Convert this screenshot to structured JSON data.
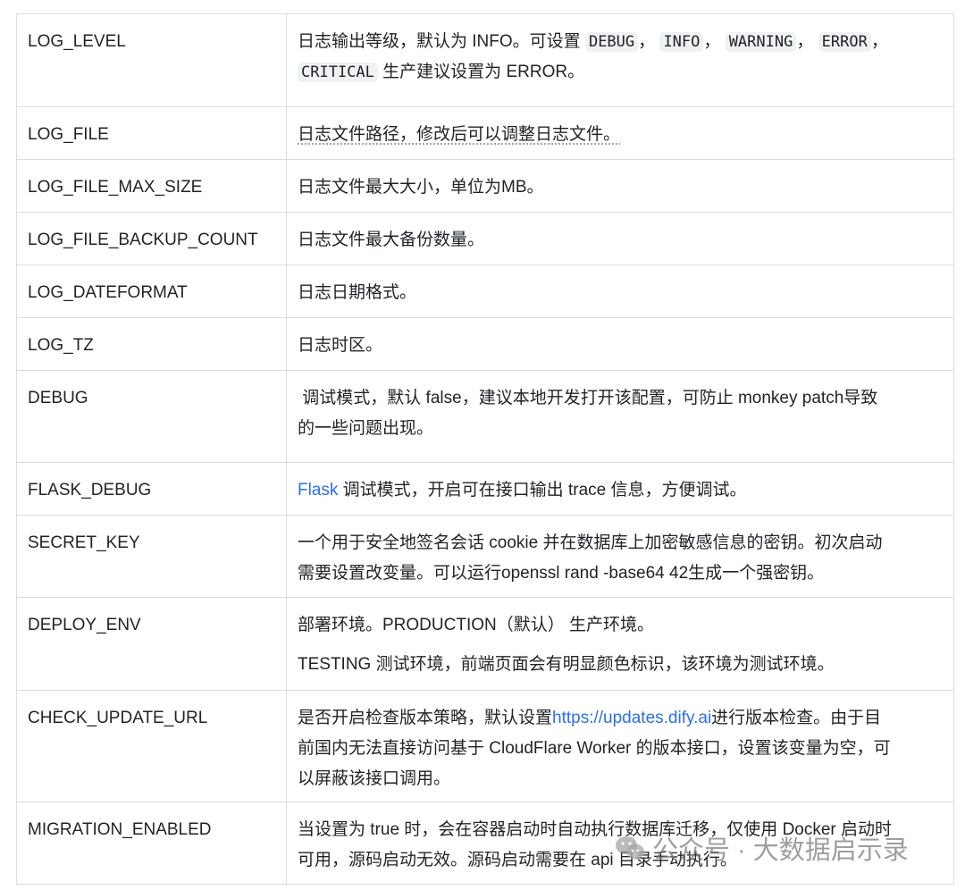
{
  "rows": [
    {
      "key": "LOG_LEVEL",
      "desc": {
        "intro": "日志输出等级，默认为 INFO。可设置",
        "codes": [
          "DEBUG",
          "INFO",
          "WARNING",
          "ERROR",
          "CRITICAL"
        ],
        "sep": "，",
        "outro": "生产建议设置为 ERROR。"
      }
    },
    {
      "key": "LOG_FILE",
      "desc": {
        "text": "日志文件路径，修改后可以调整日志文件。"
      }
    },
    {
      "key": "LOG_FILE_MAX_SIZE",
      "desc": {
        "text": "日志文件最大大小，单位为MB。"
      }
    },
    {
      "key": "LOG_FILE_BACKUP_COUNT",
      "desc": {
        "text": "日志文件最大备份数量。"
      }
    },
    {
      "key": "LOG_DATEFORMAT",
      "desc": {
        "text": "日志日期格式。"
      }
    },
    {
      "key": "LOG_TZ",
      "desc": {
        "text": "日志时区。"
      }
    },
    {
      "key": "DEBUG",
      "desc": {
        "line1": " 调试模式，默认 false，建议本地开发打开该配置，可防止 monkey patch导致",
        "line2": "的一些问题出现。"
      }
    },
    {
      "key": "FLASK_DEBUG",
      "desc": {
        "link": "Flask",
        "text": " 调试模式，开启可在接口输出 trace 信息，方便调试。"
      }
    },
    {
      "key": "SECRET_KEY",
      "desc": {
        "line1": "一个用于安全地签名会话 cookie 并在数据库上加密敏感信息的密钥。初次启动",
        "line2": "需要设置改变量。可以运行openssl rand -base64 42生成一个强密钥。"
      }
    },
    {
      "key": "DEPLOY_ENV",
      "desc": {
        "para1": "部署环境。PRODUCTION（默认） 生产环境。",
        "para2": "TESTING 测试环境，前端页面会有明显颜色标识，该环境为测试环境。"
      }
    },
    {
      "key": "CHECK_UPDATE_URL",
      "desc": {
        "pre": "是否开启检查版本策略，默认设置",
        "link": "https://updates.dify.ai",
        "post": "进行版本检查。由于目",
        "line2": "前国内无法直接访问基于 CloudFlare Worker 的版本接口，设置该变量为空，可",
        "line3": "以屏蔽该接口调用。"
      }
    },
    {
      "key": "MIGRATION_ENABLED",
      "desc": {
        "line1": "当设置为 true 时，会在容器启动时自动执行数据库迁移，仅使用 Docker 启动时",
        "line2": "可用，源码启动无效。源码启动需要在 api 目录手动执行。"
      }
    }
  ],
  "watermark": {
    "text": "公众号 · 大数据启示录",
    "icon": "wechat-icon"
  },
  "colors": {
    "border": "#d8dee4",
    "link": "#2f6fe4",
    "code_bg": "#eff1f3",
    "text": "#1f2328"
  }
}
